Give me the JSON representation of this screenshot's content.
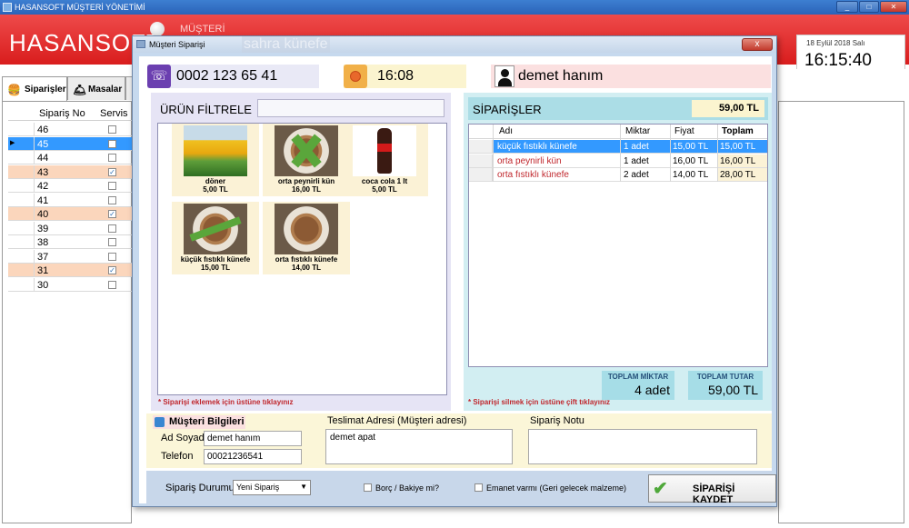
{
  "window": {
    "title": "HASANSOFT MÜŞTERİ YÖNETİMİ",
    "brand": "HASANSOFT",
    "header_sub": "MÜŞTERİ",
    "clock_date": "18 Eylül 2018 Salı",
    "clock_time": "16:15:40"
  },
  "tabs": [
    {
      "label": "Siparişler",
      "icon": "burger-icon"
    },
    {
      "label": "Masalar",
      "icon": "service-bell-icon"
    }
  ],
  "orders_grid": {
    "col_no": "Sipariş No",
    "col_service": "Servis",
    "rows": [
      {
        "no": "46",
        "servis": false
      },
      {
        "no": "45",
        "servis": false
      },
      {
        "no": "44",
        "servis": false
      },
      {
        "no": "43",
        "servis": true
      },
      {
        "no": "42",
        "servis": false
      },
      {
        "no": "41",
        "servis": false
      },
      {
        "no": "40",
        "servis": true
      },
      {
        "no": "39",
        "servis": false
      },
      {
        "no": "38",
        "servis": false
      },
      {
        "no": "37",
        "servis": false
      },
      {
        "no": "31",
        "servis": true
      },
      {
        "no": "30",
        "servis": false
      }
    ]
  },
  "dialog": {
    "title": "Müşteri Siparişi",
    "close_label": "x",
    "ghost_title": "sahra künefe",
    "phone": "0002 123 65 41",
    "time": "16:08",
    "customer": "demet hanım",
    "filter_label": "ÜRÜN FİLTRELE",
    "filter_value": "",
    "add_note": "* Siparişi eklemek için üstüne tıklayınız",
    "products": [
      {
        "name": "döner",
        "price": "5,00 TL",
        "image": "tulip-photo"
      },
      {
        "name": "orta peynirli kün",
        "price": "16,00 TL",
        "image": "kunefe-photo"
      },
      {
        "name": "coca cola 1 lt",
        "price": "5,00 TL",
        "image": "cola-bottle-photo"
      },
      {
        "name": "küçük fıstıklı künefe",
        "price": "15,00 TL",
        "image": "kunefe-photo"
      },
      {
        "name": "orta fıstıklı künefe",
        "price": "14,00 TL",
        "image": "kunefe-photo"
      }
    ],
    "orders_label": "SİPARİŞLER",
    "orders_total": "59,00 TL",
    "order_cols": {
      "name": "Adı",
      "qty": "Miktar",
      "price": "Fiyat",
      "total": "Toplam"
    },
    "order_rows": [
      {
        "name": "küçük fıstıklı künefe",
        "qty": "1 adet",
        "price": "15,00 TL",
        "total": "15,00 TL"
      },
      {
        "name": "orta peynirli kün",
        "qty": "1 adet",
        "price": "16,00 TL",
        "total": "16,00 TL"
      },
      {
        "name": "orta fıstıklı künefe",
        "qty": "2 adet",
        "price": "14,00 TL",
        "total": "28,00 TL"
      }
    ],
    "total_qty_label": "TOPLAM MİKTAR",
    "total_qty": "4 adet",
    "total_amount_label": "TOPLAM TUTAR",
    "total_amount": "59,00 TL",
    "delete_note": "* Siparişi silmek için üstüne çift tıklayınız",
    "customer_info_title": "Müşteri Bilgileri",
    "name_label": "Ad Soyad",
    "name_value": "demet hanım",
    "phone_label": "Telefon",
    "phone_value": "00021236541",
    "address_label": "Teslimat Adresi (Müşteri adresi)",
    "address_value": "demet apat",
    "note_label": "Sipariş Notu",
    "note_value": "",
    "status_label": "Sipariş Durumu",
    "status_value": "Yeni Sipariş",
    "debt_label": "Borç / Bakiye mi?",
    "trust_label": "Emanet varmı (Geri gelecek malzeme)",
    "save_label": "SİPARİŞİ KAYDET"
  },
  "colors": {
    "header_red": "#d91d1d",
    "selection_blue": "#3399ff",
    "row_highlight": "#fbd6bc"
  }
}
